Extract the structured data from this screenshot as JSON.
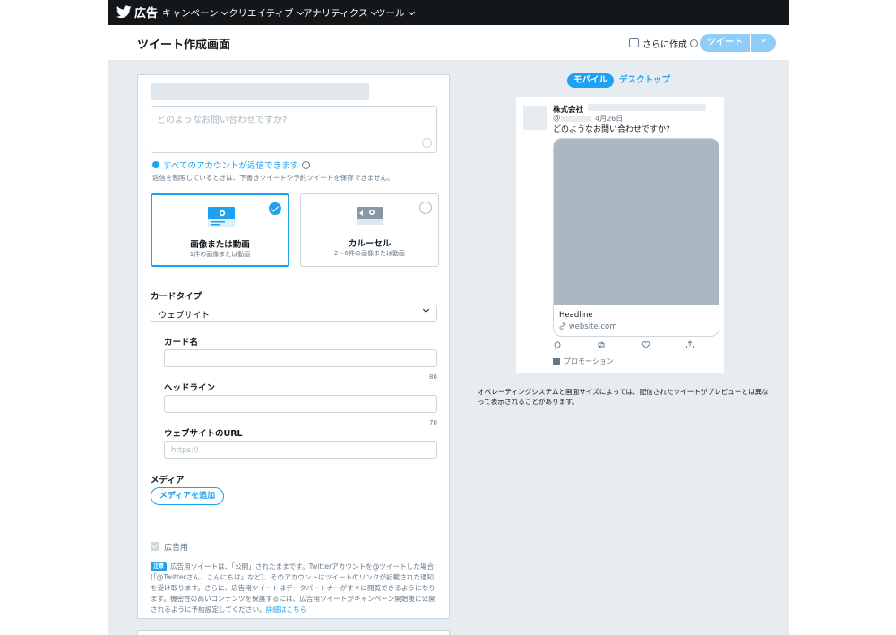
{
  "nav": {
    "logo_text": "広告",
    "items": [
      "キャンペーン",
      "クリエイティブ",
      "アナリティクス",
      "ツール"
    ]
  },
  "header": {
    "title": "ツイート作成画面",
    "more_label": "さらに作成",
    "tweet_button": "ツイート"
  },
  "composer": {
    "placeholder": "どのようなお問い合わせですか?",
    "reply_setting": "すべてのアカウントが返信できます",
    "reply_note": "返信を制限しているときは、下書きツイートや予約ツイートを保存できません。",
    "options": [
      {
        "title": "画像または動画",
        "subtitle": "1件の画像または動画",
        "selected": true
      },
      {
        "title": "カルーセル",
        "subtitle": "2〜6件の画像または動画",
        "selected": false
      }
    ]
  },
  "card": {
    "type_label": "カードタイプ",
    "type_value": "ウェブサイト",
    "name_label": "カード名",
    "name_limit": "80",
    "headline_label": "ヘッドライン",
    "headline_limit": "70",
    "url_label": "ウェブサイトのURL",
    "url_placeholder": "https://"
  },
  "media": {
    "label": "メディア",
    "add_button": "メディアを追加"
  },
  "promoted": {
    "label": "広告用",
    "note_badge": "注意",
    "note_text": "広告用ツイートは、「公開」されたままです。Twitterアカウントを@ツイートした場合(「@Twitterさん、こんにちは」など)、そのアカウントはツイートのリンクが記載された通知を受け取ります。さらに、広告用ツイートはデータパートナーがすぐに閲覧できるようになります。機密性の高いコンテンツを保護するには、広告用ツイートがキャンペーン開始後に公開されるように予約設定してください。",
    "note_link": "詳細はこちら"
  },
  "preview": {
    "tabs": [
      "モバイル",
      "デスクトップ"
    ],
    "active_tab": "モバイル",
    "name": "株式会社",
    "handle_prefix": "@",
    "date": "4月26日",
    "text": "どのようなお問い合わせですか?",
    "card_headline": "Headline",
    "card_site": "website.com",
    "promo_label": "プロモーション",
    "disclaimer": "オペレーティングシステムと画面サイズによっては、配信されたツイートがプレビューとは異なって表示されることがあります。"
  },
  "colors": {
    "accent": "#1da1f2",
    "nav_bg": "#14171a",
    "page_bg": "#e6ecf0",
    "tweet_button_disabled": "#8ecdf8"
  }
}
